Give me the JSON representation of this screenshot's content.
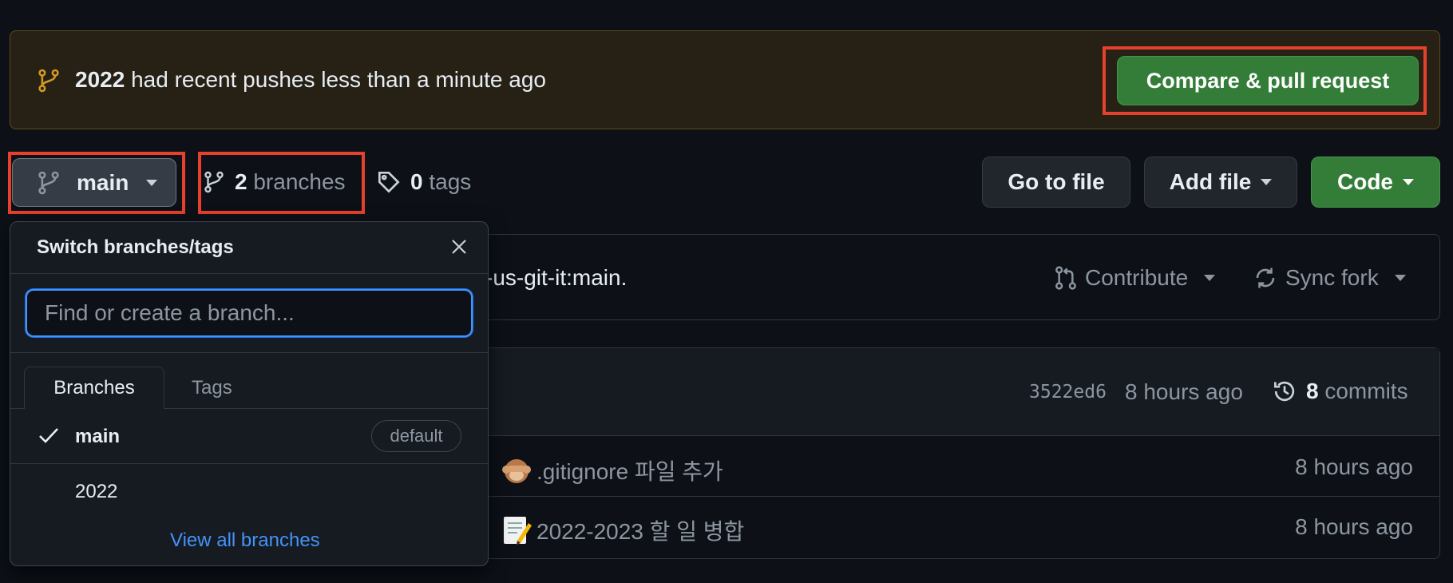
{
  "banner": {
    "branch": "2022",
    "message": " had recent pushes less than a minute ago",
    "compare_button": "Compare & pull request"
  },
  "toolbar": {
    "current_branch": "main",
    "branches_count": "2",
    "branches_label": " branches",
    "tags_count": "0",
    "tags_label": " tags",
    "go_to_file": "Go to file",
    "add_file": "Add file",
    "code": "Code"
  },
  "fork_info": {
    "text": "-us-git-it:main.",
    "contribute": "Contribute",
    "sync_fork": "Sync fork"
  },
  "latest_commit": {
    "sha": "3522ed6",
    "time": "8 hours ago",
    "commits_count": "8",
    "commits_label": " commits"
  },
  "files": [
    {
      "emoji": "see-no-evil-monkey",
      "message": ".gitignore 파일 추가",
      "time": "8 hours ago"
    },
    {
      "emoji": "memo",
      "message": "2022-2023 할 일 병합",
      "time": "8 hours ago"
    }
  ],
  "dropdown": {
    "title": "Switch branches/tags",
    "search_placeholder": "Find or create a branch...",
    "tabs": [
      "Branches",
      "Tags"
    ],
    "branches": [
      {
        "name": "main",
        "selected": true,
        "badge": "default"
      },
      {
        "name": "2022",
        "selected": false
      }
    ],
    "view_all": "View all branches"
  },
  "colors": {
    "background": "#0d1117",
    "accent_green": "#347d39",
    "link_blue": "#4493f8",
    "highlight_red": "#e5412c"
  }
}
